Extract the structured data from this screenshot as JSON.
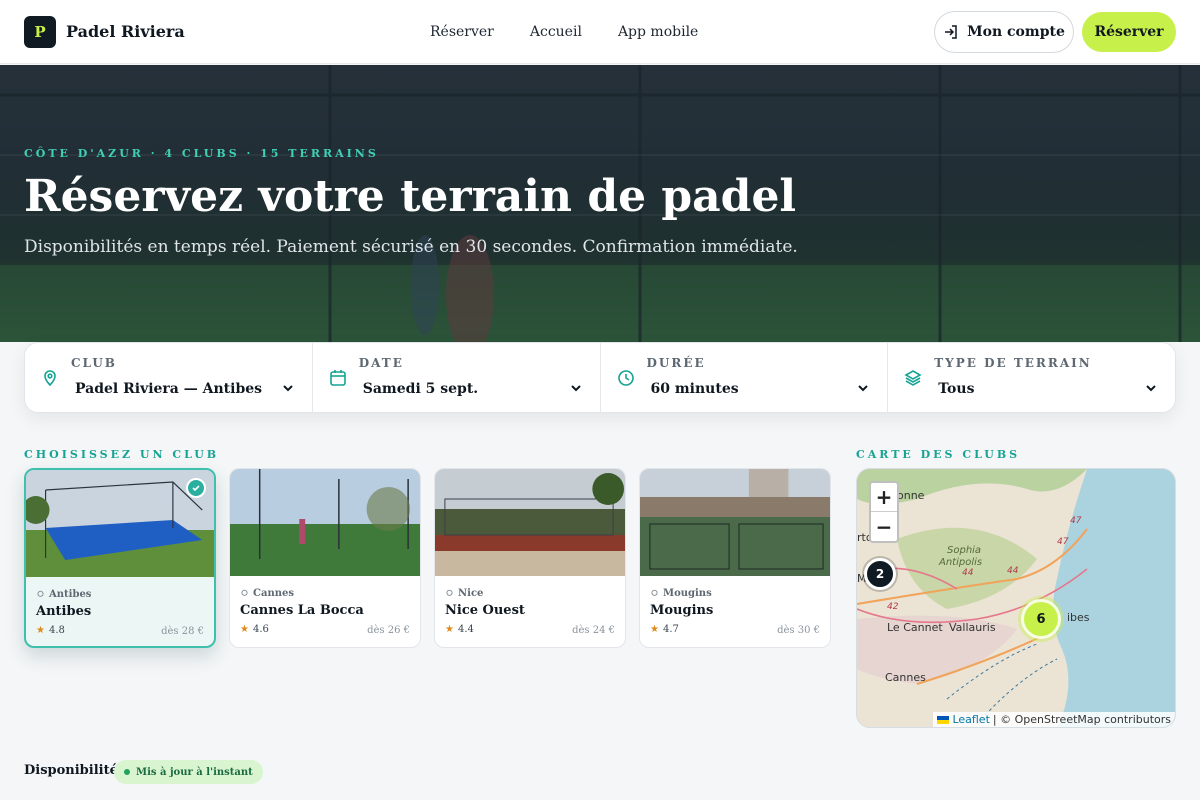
{
  "header": {
    "brand_letter": "P",
    "brand": "Padel Riviera",
    "nav": [
      "Réserver",
      "Accueil",
      "App mobile"
    ],
    "account_label": "Mon compte",
    "reserve_label": "Réserver"
  },
  "hero": {
    "kicker": "CÔTE D'AZUR · 4 CLUBS · 15 TERRAINS",
    "title": "Réservez votre terrain de padel",
    "subtitle": "Disponibilités en temps réel. Paiement sécurisé en 30 secondes. Confirmation immédiate."
  },
  "search": {
    "fields": [
      {
        "label": "CLUB",
        "value": "Padel Riviera — Antibes",
        "icon": "location-pin-icon"
      },
      {
        "label": "DATE",
        "value": "Samedi 5 sept.",
        "icon": "calendar-icon"
      },
      {
        "label": "DURÉE",
        "value": "60 minutes",
        "icon": "clock-icon"
      },
      {
        "label": "TYPE DE TERRAIN",
        "value": "Tous",
        "icon": "layers-icon"
      }
    ]
  },
  "clubs_label": "CHOISISSEZ UN CLUB",
  "clubs": [
    {
      "city": "Antibes",
      "name": "Antibes",
      "rating": "4.8",
      "price": "dès 28 €",
      "selected": true
    },
    {
      "city": "Cannes",
      "name": "Cannes La Bocca",
      "rating": "4.6",
      "price": "dès 26 €",
      "selected": false
    },
    {
      "city": "Nice",
      "name": "Nice Ouest",
      "rating": "4.4",
      "price": "dès 24 €",
      "selected": false
    },
    {
      "city": "Mougins",
      "name": "Mougins",
      "rating": "4.7",
      "price": "dès 30 €",
      "selected": false
    }
  ],
  "map": {
    "label": "CARTE DES CLUBS",
    "zoom_in": "+",
    "zoom_out": "−",
    "clusters": [
      "2",
      "6"
    ],
    "places": [
      "Sophia",
      "Antipolis",
      "Le Cannet",
      "Vallauris",
      "Cannes",
      "onne",
      "ibes",
      "rton",
      "Mo"
    ],
    "roads": [
      "44",
      "44",
      "42",
      "47",
      "47"
    ],
    "attribution_link": "Leaflet",
    "attribution_text": "| © OpenStreetMap contributors"
  },
  "availability": {
    "title": "Disponibilités",
    "badge": "Mis à jour à l'instant"
  },
  "colors": {
    "accent_lime": "#c8f04a",
    "teal": "#16a394",
    "dark": "#0f1a22"
  }
}
